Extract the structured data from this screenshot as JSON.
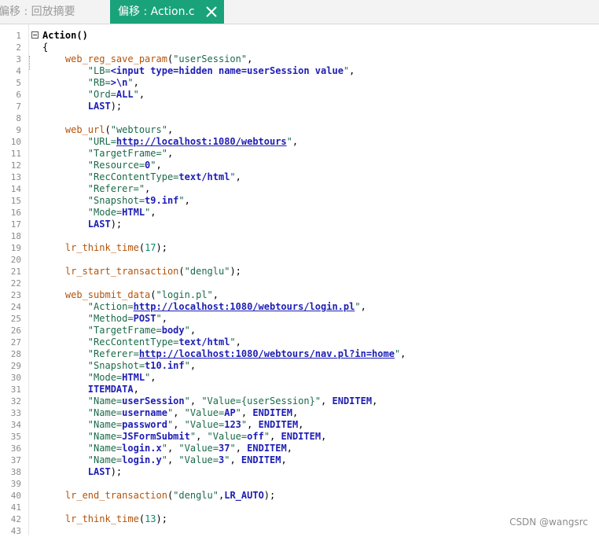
{
  "tabs": {
    "inactive_label": "偏移 : 回放摘要",
    "active_label": "偏移 : Action.c"
  },
  "watermark": "CSDN @wangsrc",
  "lines": [
    {
      "n": "1",
      "segs": [
        [
          "bold",
          "Action()"
        ]
      ]
    },
    {
      "n": "2",
      "segs": [
        [
          "plain",
          "{"
        ]
      ]
    },
    {
      "n": "3",
      "segs": [
        [
          "plain",
          "    "
        ],
        [
          "fn",
          "web_reg_save_param"
        ],
        [
          "plain",
          "("
        ],
        [
          "str",
          "\"userSession\""
        ],
        [
          "plain",
          ","
        ]
      ]
    },
    {
      "n": "4",
      "segs": [
        [
          "plain",
          "        "
        ],
        [
          "str",
          "\"LB="
        ],
        [
          "kw",
          "<input type=hidden name=userSession value"
        ],
        [
          "str",
          "\""
        ],
        [
          "plain",
          ","
        ]
      ]
    },
    {
      "n": "5",
      "segs": [
        [
          "plain",
          "        "
        ],
        [
          "str",
          "\"RB="
        ],
        [
          "kw",
          ">\\n"
        ],
        [
          "str",
          "\""
        ],
        [
          "plain",
          ","
        ]
      ]
    },
    {
      "n": "6",
      "segs": [
        [
          "plain",
          "        "
        ],
        [
          "str",
          "\"Ord="
        ],
        [
          "kw",
          "ALL"
        ],
        [
          "str",
          "\""
        ],
        [
          "plain",
          ","
        ]
      ]
    },
    {
      "n": "7",
      "segs": [
        [
          "plain",
          "        "
        ],
        [
          "kw",
          "LAST"
        ],
        [
          "plain",
          ");"
        ]
      ]
    },
    {
      "n": "8",
      "segs": []
    },
    {
      "n": "9",
      "segs": [
        [
          "plain",
          "    "
        ],
        [
          "fn",
          "web_url"
        ],
        [
          "plain",
          "("
        ],
        [
          "str",
          "\"webtours\""
        ],
        [
          "plain",
          ","
        ]
      ]
    },
    {
      "n": "10",
      "segs": [
        [
          "plain",
          "        "
        ],
        [
          "str",
          "\"URL="
        ],
        [
          "url",
          "http://localhost:1080/webtours"
        ],
        [
          "str",
          "\""
        ],
        [
          "plain",
          ","
        ]
      ]
    },
    {
      "n": "11",
      "segs": [
        [
          "plain",
          "        "
        ],
        [
          "str",
          "\"TargetFrame=\""
        ],
        [
          "plain",
          ","
        ]
      ]
    },
    {
      "n": "12",
      "segs": [
        [
          "plain",
          "        "
        ],
        [
          "str",
          "\"Resource="
        ],
        [
          "kw",
          "0"
        ],
        [
          "str",
          "\""
        ],
        [
          "plain",
          ","
        ]
      ]
    },
    {
      "n": "13",
      "segs": [
        [
          "plain",
          "        "
        ],
        [
          "str",
          "\"RecContentType="
        ],
        [
          "kw",
          "text/html"
        ],
        [
          "str",
          "\""
        ],
        [
          "plain",
          ","
        ]
      ]
    },
    {
      "n": "14",
      "segs": [
        [
          "plain",
          "        "
        ],
        [
          "str",
          "\"Referer=\""
        ],
        [
          "plain",
          ","
        ]
      ]
    },
    {
      "n": "15",
      "segs": [
        [
          "plain",
          "        "
        ],
        [
          "str",
          "\"Snapshot="
        ],
        [
          "kw",
          "t9.inf"
        ],
        [
          "str",
          "\""
        ],
        [
          "plain",
          ","
        ]
      ]
    },
    {
      "n": "16",
      "segs": [
        [
          "plain",
          "        "
        ],
        [
          "str",
          "\"Mode="
        ],
        [
          "kw",
          "HTML"
        ],
        [
          "str",
          "\""
        ],
        [
          "plain",
          ","
        ]
      ]
    },
    {
      "n": "17",
      "segs": [
        [
          "plain",
          "        "
        ],
        [
          "kw",
          "LAST"
        ],
        [
          "plain",
          ");"
        ]
      ]
    },
    {
      "n": "18",
      "segs": []
    },
    {
      "n": "19",
      "segs": [
        [
          "plain",
          "    "
        ],
        [
          "fn",
          "lr_think_time"
        ],
        [
          "plain",
          "("
        ],
        [
          "num",
          "17"
        ],
        [
          "plain",
          ");"
        ]
      ]
    },
    {
      "n": "20",
      "segs": []
    },
    {
      "n": "21",
      "segs": [
        [
          "plain",
          "    "
        ],
        [
          "fn",
          "lr_start_transaction"
        ],
        [
          "plain",
          "("
        ],
        [
          "str",
          "\"denglu\""
        ],
        [
          "plain",
          ");"
        ]
      ]
    },
    {
      "n": "22",
      "segs": []
    },
    {
      "n": "23",
      "segs": [
        [
          "plain",
          "    "
        ],
        [
          "fn",
          "web_submit_data"
        ],
        [
          "plain",
          "("
        ],
        [
          "str",
          "\"login.pl\""
        ],
        [
          "plain",
          ","
        ]
      ]
    },
    {
      "n": "24",
      "segs": [
        [
          "plain",
          "        "
        ],
        [
          "str",
          "\"Action="
        ],
        [
          "url",
          "http://localhost:1080/webtours/login.pl"
        ],
        [
          "str",
          "\""
        ],
        [
          "plain",
          ","
        ]
      ]
    },
    {
      "n": "25",
      "segs": [
        [
          "plain",
          "        "
        ],
        [
          "str",
          "\"Method="
        ],
        [
          "kw",
          "POST"
        ],
        [
          "str",
          "\""
        ],
        [
          "plain",
          ","
        ]
      ]
    },
    {
      "n": "26",
      "segs": [
        [
          "plain",
          "        "
        ],
        [
          "str",
          "\"TargetFrame="
        ],
        [
          "kw",
          "body"
        ],
        [
          "str",
          "\""
        ],
        [
          "plain",
          ","
        ]
      ]
    },
    {
      "n": "27",
      "segs": [
        [
          "plain",
          "        "
        ],
        [
          "str",
          "\"RecContentType="
        ],
        [
          "kw",
          "text/html"
        ],
        [
          "str",
          "\""
        ],
        [
          "plain",
          ","
        ]
      ]
    },
    {
      "n": "28",
      "segs": [
        [
          "plain",
          "        "
        ],
        [
          "str",
          "\"Referer="
        ],
        [
          "url",
          "http://localhost:1080/webtours/nav.pl?in=home"
        ],
        [
          "str",
          "\""
        ],
        [
          "plain",
          ","
        ]
      ]
    },
    {
      "n": "29",
      "segs": [
        [
          "plain",
          "        "
        ],
        [
          "str",
          "\"Snapshot="
        ],
        [
          "kw",
          "t10.inf"
        ],
        [
          "str",
          "\""
        ],
        [
          "plain",
          ","
        ]
      ]
    },
    {
      "n": "30",
      "segs": [
        [
          "plain",
          "        "
        ],
        [
          "str",
          "\"Mode="
        ],
        [
          "kw",
          "HTML"
        ],
        [
          "str",
          "\""
        ],
        [
          "plain",
          ","
        ]
      ]
    },
    {
      "n": "31",
      "segs": [
        [
          "plain",
          "        "
        ],
        [
          "kw",
          "ITEMDATA"
        ],
        [
          "plain",
          ","
        ]
      ]
    },
    {
      "n": "32",
      "segs": [
        [
          "plain",
          "        "
        ],
        [
          "str",
          "\"Name="
        ],
        [
          "kw",
          "userSession"
        ],
        [
          "str",
          "\""
        ],
        [
          "plain",
          ", "
        ],
        [
          "str",
          "\"Value={userSession}\""
        ],
        [
          "plain",
          ", "
        ],
        [
          "kw",
          "ENDITEM"
        ],
        [
          "plain",
          ","
        ]
      ]
    },
    {
      "n": "33",
      "segs": [
        [
          "plain",
          "        "
        ],
        [
          "str",
          "\"Name="
        ],
        [
          "kw",
          "username"
        ],
        [
          "str",
          "\""
        ],
        [
          "plain",
          ", "
        ],
        [
          "str",
          "\"Value="
        ],
        [
          "kw",
          "AP"
        ],
        [
          "str",
          "\""
        ],
        [
          "plain",
          ", "
        ],
        [
          "kw",
          "ENDITEM"
        ],
        [
          "plain",
          ","
        ]
      ]
    },
    {
      "n": "34",
      "segs": [
        [
          "plain",
          "        "
        ],
        [
          "str",
          "\"Name="
        ],
        [
          "kw",
          "password"
        ],
        [
          "str",
          "\""
        ],
        [
          "plain",
          ", "
        ],
        [
          "str",
          "\"Value="
        ],
        [
          "kw",
          "123"
        ],
        [
          "str",
          "\""
        ],
        [
          "plain",
          ", "
        ],
        [
          "kw",
          "ENDITEM"
        ],
        [
          "plain",
          ","
        ]
      ]
    },
    {
      "n": "35",
      "segs": [
        [
          "plain",
          "        "
        ],
        [
          "str",
          "\"Name="
        ],
        [
          "kw",
          "JSFormSubmit"
        ],
        [
          "str",
          "\""
        ],
        [
          "plain",
          ", "
        ],
        [
          "str",
          "\"Value="
        ],
        [
          "kw",
          "off"
        ],
        [
          "str",
          "\""
        ],
        [
          "plain",
          ", "
        ],
        [
          "kw",
          "ENDITEM"
        ],
        [
          "plain",
          ","
        ]
      ]
    },
    {
      "n": "36",
      "segs": [
        [
          "plain",
          "        "
        ],
        [
          "str",
          "\"Name="
        ],
        [
          "kw",
          "login.x"
        ],
        [
          "str",
          "\""
        ],
        [
          "plain",
          ", "
        ],
        [
          "str",
          "\"Value="
        ],
        [
          "kw",
          "37"
        ],
        [
          "str",
          "\""
        ],
        [
          "plain",
          ", "
        ],
        [
          "kw",
          "ENDITEM"
        ],
        [
          "plain",
          ","
        ]
      ]
    },
    {
      "n": "37",
      "segs": [
        [
          "plain",
          "        "
        ],
        [
          "str",
          "\"Name="
        ],
        [
          "kw",
          "login.y"
        ],
        [
          "str",
          "\""
        ],
        [
          "plain",
          ", "
        ],
        [
          "str",
          "\"Value="
        ],
        [
          "kw",
          "3"
        ],
        [
          "str",
          "\""
        ],
        [
          "plain",
          ", "
        ],
        [
          "kw",
          "ENDITEM"
        ],
        [
          "plain",
          ","
        ]
      ]
    },
    {
      "n": "38",
      "segs": [
        [
          "plain",
          "        "
        ],
        [
          "kw",
          "LAST"
        ],
        [
          "plain",
          ");"
        ]
      ]
    },
    {
      "n": "39",
      "segs": []
    },
    {
      "n": "40",
      "segs": [
        [
          "plain",
          "    "
        ],
        [
          "fn",
          "lr_end_transaction"
        ],
        [
          "plain",
          "("
        ],
        [
          "str",
          "\"denglu\""
        ],
        [
          "plain",
          ","
        ],
        [
          "kw",
          "LR_AUTO"
        ],
        [
          "plain",
          ");"
        ]
      ]
    },
    {
      "n": "41",
      "segs": []
    },
    {
      "n": "42",
      "segs": [
        [
          "plain",
          "    "
        ],
        [
          "fn",
          "lr_think_time"
        ],
        [
          "plain",
          "("
        ],
        [
          "num",
          "13"
        ],
        [
          "plain",
          ");"
        ]
      ]
    },
    {
      "n": "43",
      "segs": []
    }
  ]
}
